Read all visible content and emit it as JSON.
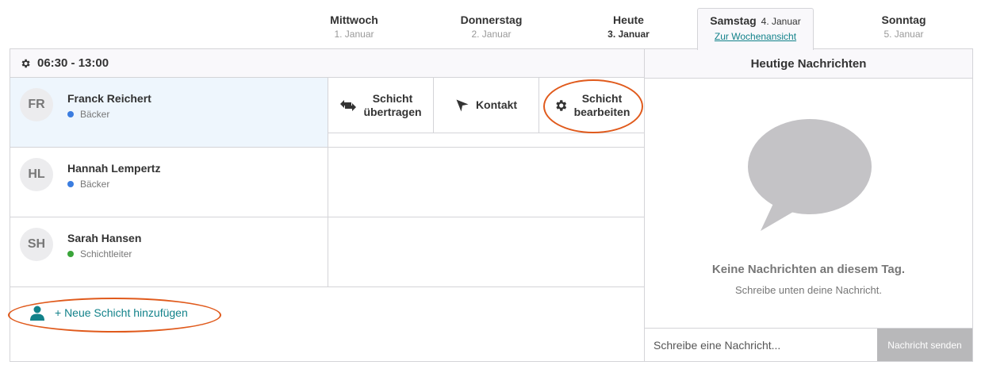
{
  "days": [
    {
      "name": "Mittwoch",
      "date": "1. Januar"
    },
    {
      "name": "Donnerstag",
      "date": "2. Januar"
    },
    {
      "name": "Heute",
      "date": "3. Januar"
    },
    {
      "name": "Samstag",
      "date": "4. Januar",
      "link": "Zur Wochenansicht"
    },
    {
      "name": "Sonntag",
      "date": "5. Januar"
    }
  ],
  "shift": {
    "time": "06:30 - 13:00",
    "people": [
      {
        "initials": "FR",
        "name": "Franck Reichert",
        "role": "Bäcker",
        "role_color": "#3b7de0"
      },
      {
        "initials": "HL",
        "name": "Hannah Lempertz",
        "role": "Bäcker",
        "role_color": "#3b7de0"
      },
      {
        "initials": "SH",
        "name": "Sarah Hansen",
        "role": "Schichtleiter",
        "role_color": "#3aa53a"
      }
    ],
    "actions": {
      "transfer_line1": "Schicht",
      "transfer_line2": "übertragen",
      "contact": "Kontakt",
      "edit_line1": "Schicht",
      "edit_line2": "bearbeiten"
    },
    "add_label": "+ Neue Schicht hinzufügen"
  },
  "messages": {
    "title": "Heutige Nachrichten",
    "empty_title": "Keine Nachrichten an diesem Tag.",
    "empty_sub": "Schreibe unten deine Nachricht.",
    "placeholder": "Schreibe eine Nachricht...",
    "send_label": "Nachricht senden"
  },
  "colors": {
    "accent": "#12828a",
    "highlight": "#e05a1c"
  },
  "icons": [
    "gear-icon",
    "swap-arrows-icon",
    "send-plane-icon",
    "user-icon",
    "speech-bubble-icon"
  ]
}
